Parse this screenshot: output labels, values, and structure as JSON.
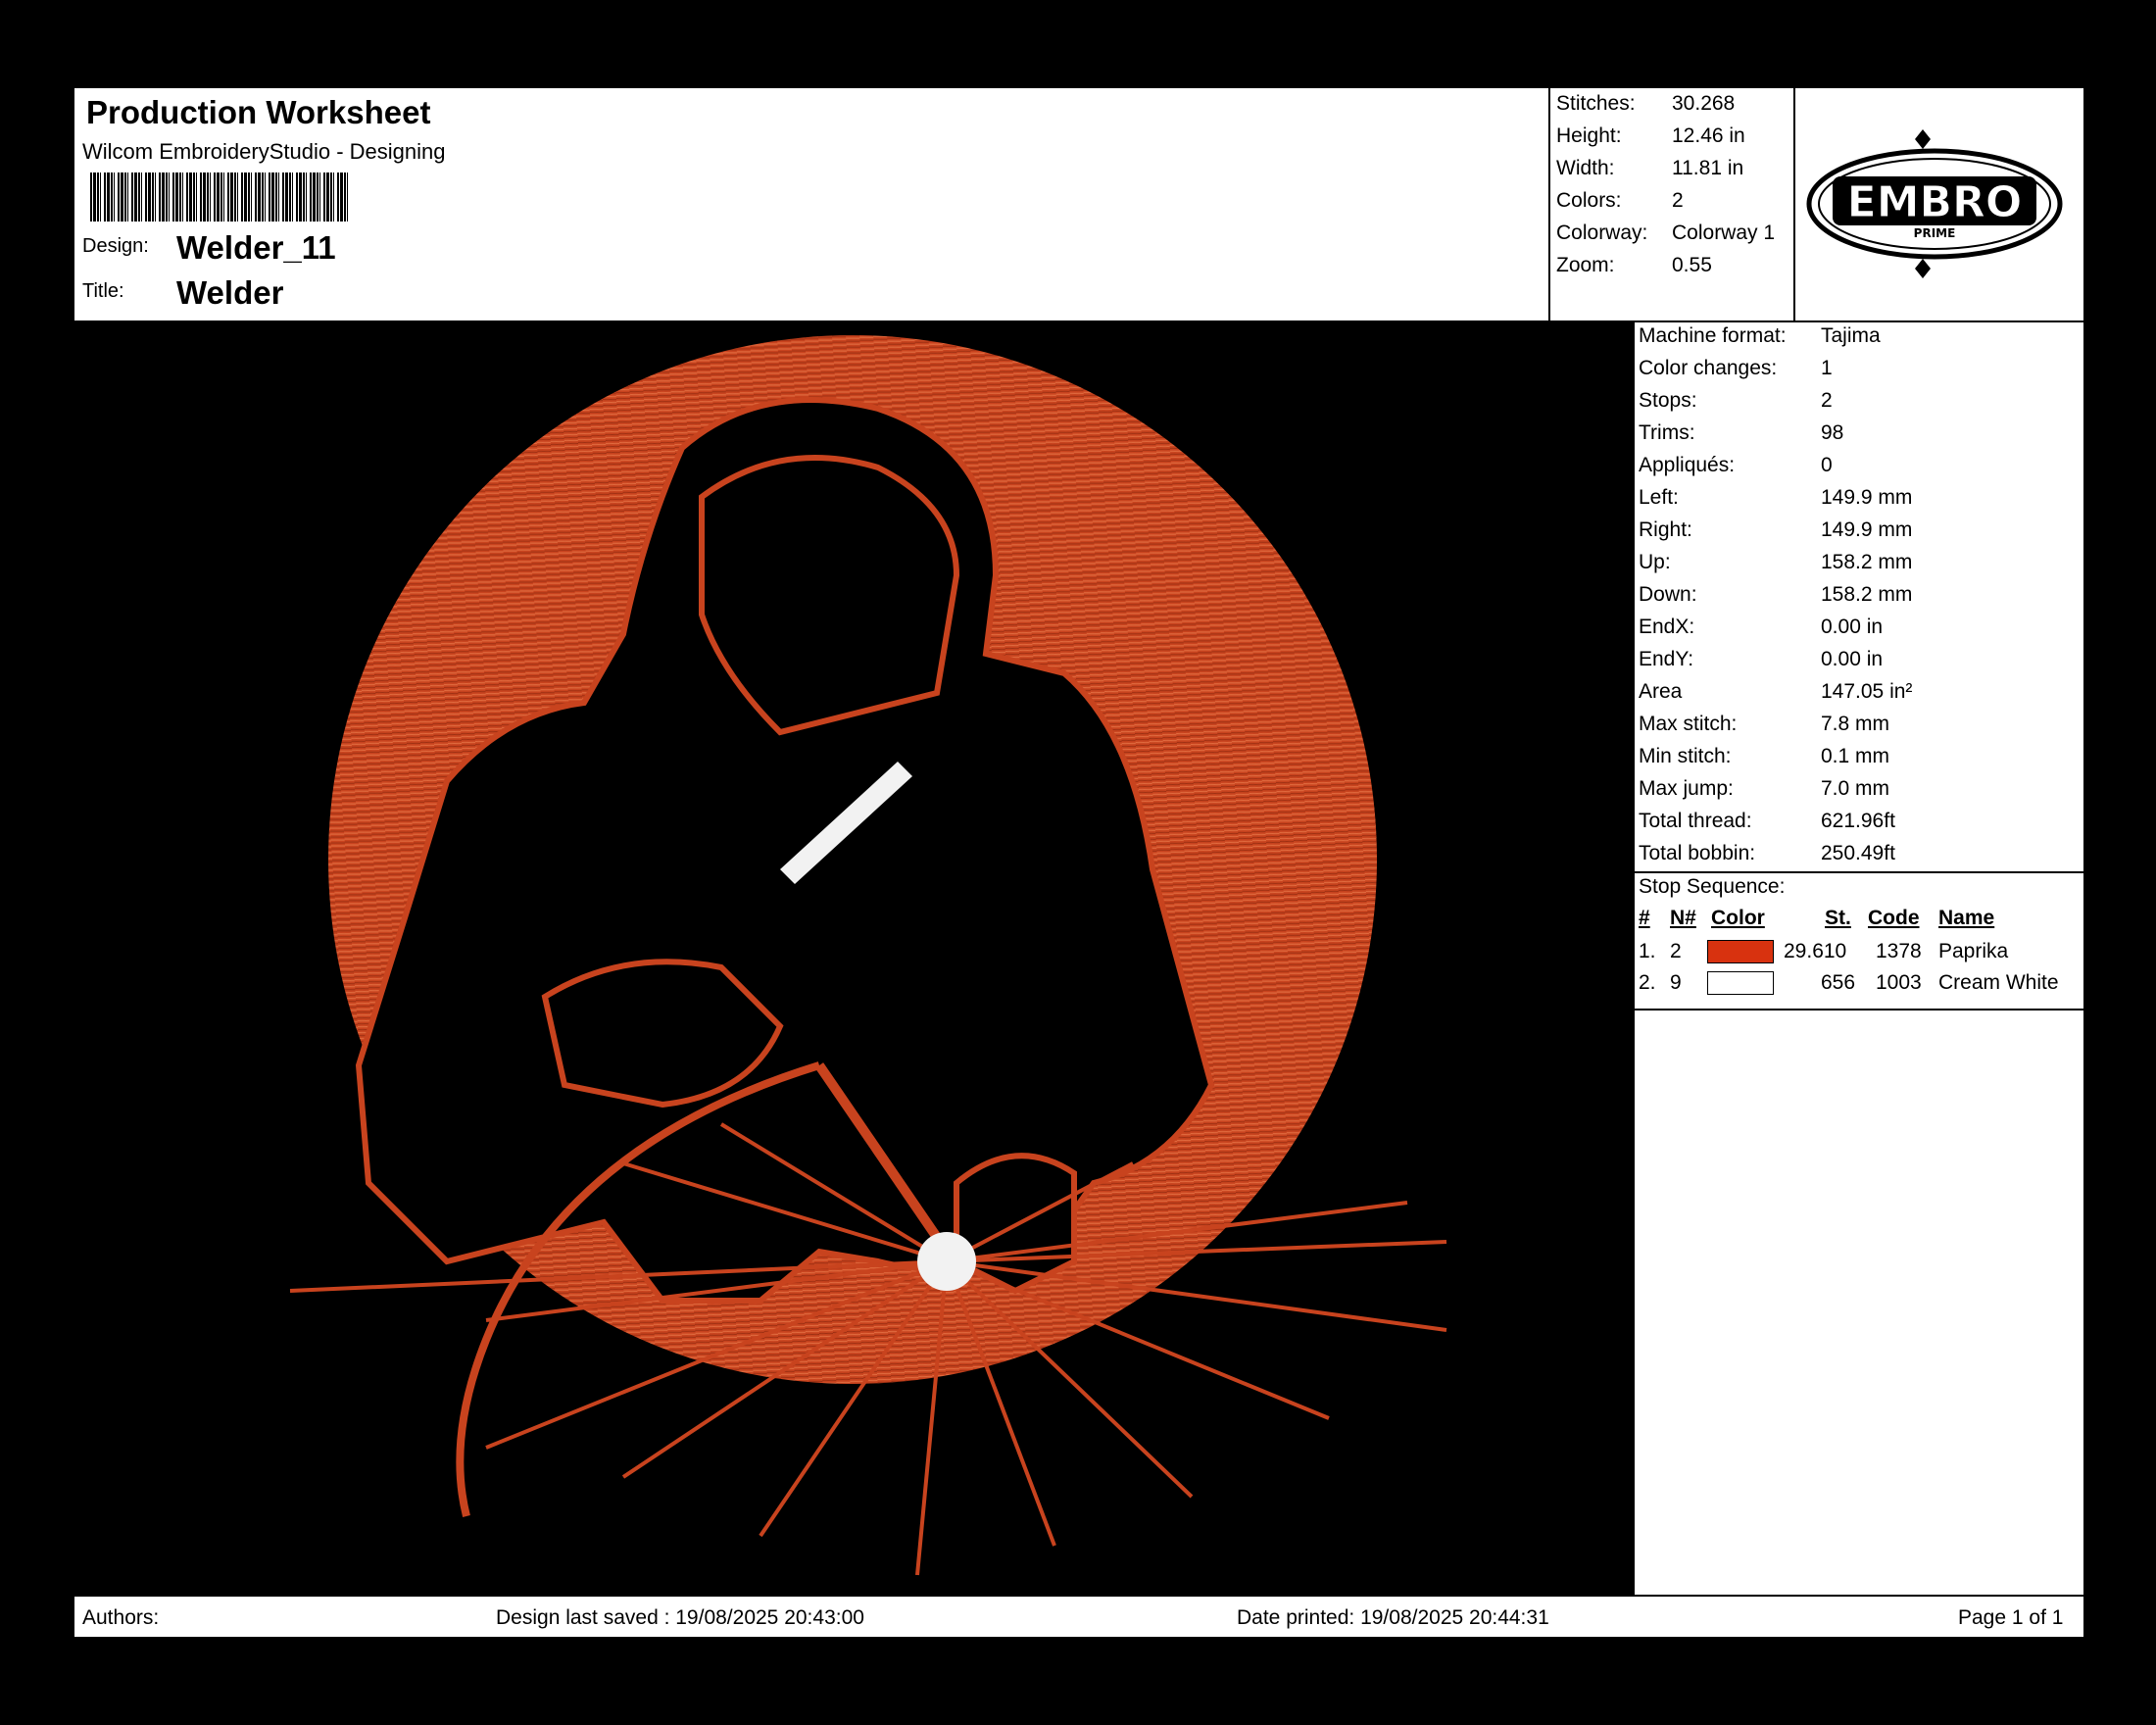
{
  "header": {
    "title": "Production Worksheet",
    "software": "Wilcom EmbroideryStudio - Designing",
    "design_label": "Design:",
    "design_value": "Welder_11",
    "title_label": "Title:",
    "title_value": "Welder"
  },
  "stats_top": [
    {
      "label": "Stitches:",
      "value": "30.268"
    },
    {
      "label": "Height:",
      "value": "12.46 in"
    },
    {
      "label": "Width:",
      "value": "11.81 in"
    },
    {
      "label": "Colors:",
      "value": "2"
    },
    {
      "label": "Colorway:",
      "value": "Colorway 1"
    },
    {
      "label": "Zoom:",
      "value": "0.55"
    }
  ],
  "logo": {
    "main": "EMBRO",
    "sub": "PRIME"
  },
  "info": [
    {
      "label": "Machine format:",
      "value": "Tajima"
    },
    {
      "label": "Color changes:",
      "value": "1"
    },
    {
      "label": "Stops:",
      "value": "2"
    },
    {
      "label": "Trims:",
      "value": "98"
    },
    {
      "label": "Appliqués:",
      "value": "0"
    },
    {
      "label": "Left:",
      "value": "149.9 mm"
    },
    {
      "label": "Right:",
      "value": "149.9 mm"
    },
    {
      "label": "Up:",
      "value": "158.2 mm"
    },
    {
      "label": "Down:",
      "value": "158.2 mm"
    },
    {
      "label": "EndX:",
      "value": "0.00 in"
    },
    {
      "label": "EndY:",
      "value": "0.00 in"
    },
    {
      "label": "Area",
      "value": "147.05 in²"
    },
    {
      "label": "Max stitch:",
      "value": "7.8 mm"
    },
    {
      "label": "Min stitch:",
      "value": "0.1 mm"
    },
    {
      "label": "Max jump:",
      "value": "7.0 mm"
    },
    {
      "label": "Total thread:",
      "value": "621.96ft"
    },
    {
      "label": "Total bobbin:",
      "value": "250.49ft"
    }
  ],
  "stop_sequence": {
    "title": "Stop Sequence:",
    "headers": {
      "num": "#",
      "needle": "N#",
      "color": "Color",
      "stitches": "St.",
      "code": "Code",
      "name": "Name"
    },
    "rows": [
      {
        "num": "1.",
        "needle": "2",
        "swatch": "#d8320f",
        "stitches": "29.610",
        "code": "1378",
        "name": "Paprika"
      },
      {
        "num": "2.",
        "needle": "9",
        "swatch": "#ffffff",
        "stitches": "656",
        "code": "1003",
        "name": "Cream White"
      }
    ]
  },
  "footer": {
    "authors": "Authors:",
    "saved": "Design last saved : 19/08/2025 20:43:00",
    "printed": "Date printed: 19/08/2025 20:44:31",
    "page": "Page 1 of 1"
  },
  "colors": {
    "thread": "#c8431e",
    "thread_light": "#e06a3e",
    "background": "#000000"
  }
}
